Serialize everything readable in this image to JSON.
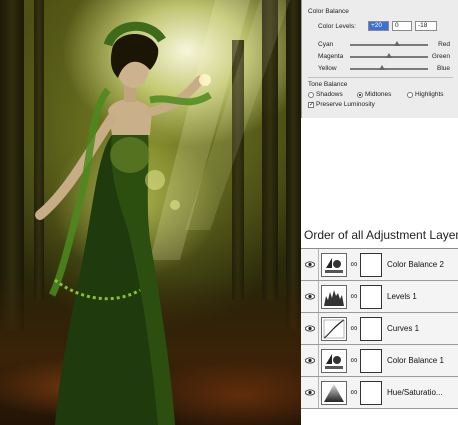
{
  "color_balance": {
    "section_title": "Color Balance",
    "levels_label": "Color Levels:",
    "levels": [
      "+20",
      "0",
      "-18"
    ],
    "sliders": [
      {
        "left": "Cyan",
        "right": "Red",
        "value": 20
      },
      {
        "left": "Magenta",
        "right": "Green",
        "value": 0
      },
      {
        "left": "Yellow",
        "right": "Blue",
        "value": -18
      }
    ],
    "tone_balance": {
      "title": "Tone Balance",
      "options": [
        "Shadows",
        "Midtones",
        "Highlights"
      ],
      "selected": "Midtones",
      "preserve_luminosity": "Preserve Luminosity",
      "preserve_checked": true
    }
  },
  "layers_panel": {
    "heading": "Order of all Adjustment Layers",
    "layers": [
      {
        "name": "Color Balance 2",
        "icon": "color-balance-icon"
      },
      {
        "name": "Levels 1",
        "icon": "levels-icon"
      },
      {
        "name": "Curves 1",
        "icon": "curves-icon"
      },
      {
        "name": "Color Balance 1",
        "icon": "color-balance-icon"
      },
      {
        "name": "Hue/Saturatio...",
        "icon": "hue-saturation-icon"
      }
    ]
  },
  "colors": {
    "selected_field": "#3d6fd6",
    "panel_bg": "#ececec"
  }
}
